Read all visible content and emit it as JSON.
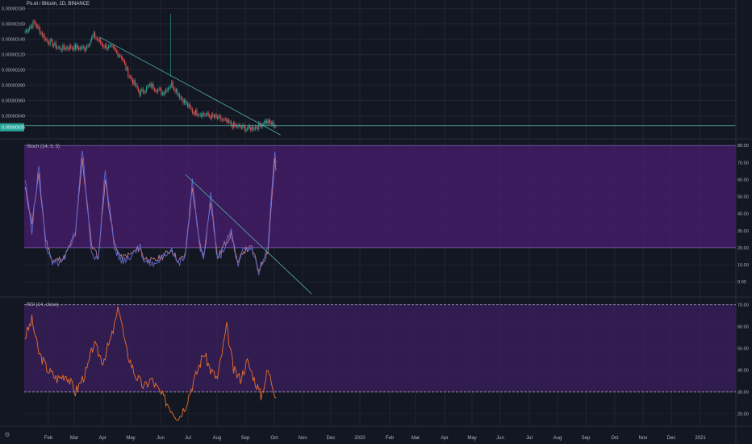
{
  "symbol": {
    "title": "Po.et / Bitcoin, 1D, BINANCE"
  },
  "colors": {
    "background": "#131722",
    "grid": "#2a2e39",
    "up": "#26a69a",
    "down": "#ef5350",
    "trendline": "#4fb2a6",
    "stoch_k": "#5b6cd6",
    "stoch_d": "#c07a8e",
    "stoch_band": "#4a1d70",
    "rsi_line": "#e8702a",
    "rsi_band": "#3a1e5c",
    "price_badge": "#26a69a"
  },
  "icons": {
    "settings": "gear-icon"
  },
  "chart_data": [
    {
      "type": "candlestick",
      "pane": "price",
      "title": "Po.et / Bitcoin, 1D, BINANCE",
      "ylim": [
        1.2e-07,
        1.85e-06
      ],
      "y_ticks": [
        "0.00000180",
        "0.00000160",
        "0.00000140",
        "0.00000120",
        "0.00000100",
        "0.00000080",
        "0.00000060",
        "0.00000040"
      ],
      "last_price_label": "0.00000025",
      "last_price": 2.5e-07,
      "series": [
        {
          "name": "",
          "x_index_range": [
            0,
            219
          ],
          "anchors": [
            [
              0,
              1.5e-06
            ],
            [
              8,
              1.62e-06
            ],
            [
              18,
              1.4e-06
            ],
            [
              30,
              1.28e-06
            ],
            [
              40,
              1.3e-06
            ],
            [
              52,
              1.28e-06
            ],
            [
              60,
              1.45e-06
            ],
            [
              68,
              1.32e-06
            ],
            [
              76,
              1.28e-06
            ],
            [
              84,
              1.18e-06
            ],
            [
              90,
              9.5e-07
            ],
            [
              100,
              7e-07
            ],
            [
              110,
              8e-07
            ],
            [
              120,
              7e-07
            ],
            [
              128,
              8.2e-07
            ],
            [
              136,
              6.4e-07
            ],
            [
              146,
              4.6e-07
            ],
            [
              156,
              4.2e-07
            ],
            [
              170,
              3.6e-07
            ],
            [
              182,
              2.7e-07
            ],
            [
              195,
              2.3e-07
            ],
            [
              204,
              2.7e-07
            ],
            [
              210,
              3.3e-07
            ],
            [
              219,
              2.7e-07
            ]
          ]
        }
      ],
      "trendlines": [
        {
          "from": [
            65,
            1.43e-06
          ],
          "to": [
            223,
            1.5e-07
          ]
        },
        {
          "from": [
            0,
            2.7e-07
          ],
          "to": [
            620,
            2.7e-07
          ]
        }
      ]
    },
    {
      "type": "line",
      "pane": "stoch",
      "title": "Stoch (14, 3, 3)",
      "ylim": [
        -8,
        82
      ],
      "y_ticks": [
        "80.00",
        "70.00",
        "60.00",
        "50.00",
        "40.00",
        "30.00",
        "20.00",
        "10.00",
        "0.00"
      ],
      "band": [
        20,
        80
      ],
      "series": [
        {
          "name": "",
          "x_index_range": [
            0,
            219
          ],
          "anchors": [
            [
              0,
              60
            ],
            [
              6,
              30
            ],
            [
              12,
              68
            ],
            [
              18,
              22
            ],
            [
              24,
              10
            ],
            [
              34,
              12
            ],
            [
              44,
              30
            ],
            [
              50,
              78
            ],
            [
              58,
              18
            ],
            [
              64,
              12
            ],
            [
              70,
              66
            ],
            [
              78,
              20
            ],
            [
              84,
              12
            ],
            [
              92,
              15
            ],
            [
              100,
              22
            ],
            [
              104,
              12
            ],
            [
              112,
              10
            ],
            [
              120,
              14
            ],
            [
              128,
              20
            ],
            [
              134,
              10
            ],
            [
              140,
              15
            ],
            [
              146,
              60
            ],
            [
              152,
              22
            ],
            [
              156,
              12
            ],
            [
              162,
              52
            ],
            [
              168,
              12
            ],
            [
              174,
              20
            ],
            [
              180,
              30
            ],
            [
              186,
              8
            ],
            [
              190,
              18
            ],
            [
              198,
              20
            ],
            [
              204,
              5
            ],
            [
              212,
              20
            ],
            [
              218,
              78
            ],
            [
              224,
              22
            ],
            [
              228,
              12
            ]
          ]
        },
        {
          "name": "",
          "x_index_range": [
            0,
            219
          ],
          "anchors": [
            [
              0,
              55
            ],
            [
              6,
              35
            ],
            [
              12,
              62
            ],
            [
              18,
              25
            ],
            [
              24,
              12
            ],
            [
              34,
              14
            ],
            [
              44,
              28
            ],
            [
              50,
              72
            ],
            [
              58,
              22
            ],
            [
              64,
              14
            ],
            [
              70,
              60
            ],
            [
              78,
              22
            ],
            [
              84,
              14
            ],
            [
              92,
              16
            ],
            [
              100,
              20
            ],
            [
              104,
              14
            ],
            [
              112,
              12
            ],
            [
              120,
              15
            ],
            [
              128,
              19
            ],
            [
              134,
              12
            ],
            [
              140,
              16
            ],
            [
              146,
              55
            ],
            [
              152,
              24
            ],
            [
              156,
              14
            ],
            [
              162,
              48
            ],
            [
              168,
              14
            ],
            [
              174,
              22
            ],
            [
              180,
              28
            ],
            [
              186,
              10
            ],
            [
              190,
              18
            ],
            [
              198,
              20
            ],
            [
              204,
              7
            ],
            [
              212,
              18
            ],
            [
              218,
              72
            ],
            [
              224,
              26
            ],
            [
              228,
              14
            ]
          ]
        }
      ],
      "trendlines": [
        {
          "from": [
            140,
            63
          ],
          "to": [
            250,
            -7
          ]
        }
      ]
    },
    {
      "type": "line",
      "pane": "rsi",
      "title": "RSI (14, close)",
      "ylim": [
        15,
        72
      ],
      "y_ticks": [
        "70.00",
        "60.00",
        "50.00",
        "40.00",
        "30.00",
        "20.00"
      ],
      "band": [
        30,
        70
      ],
      "series": [
        {
          "name": "",
          "x_index_range": [
            0,
            219
          ],
          "anchors": [
            [
              0,
              55
            ],
            [
              6,
              63
            ],
            [
              12,
              48
            ],
            [
              20,
              40
            ],
            [
              28,
              36
            ],
            [
              36,
              38
            ],
            [
              44,
              30
            ],
            [
              54,
              40
            ],
            [
              60,
              52
            ],
            [
              68,
              44
            ],
            [
              76,
              56
            ],
            [
              82,
              69
            ],
            [
              88,
              50
            ],
            [
              96,
              38
            ],
            [
              104,
              32
            ],
            [
              110,
              36
            ],
            [
              120,
              28
            ],
            [
              128,
              22
            ],
            [
              134,
              18
            ],
            [
              140,
              24
            ],
            [
              148,
              36
            ],
            [
              156,
              48
            ],
            [
              162,
              40
            ],
            [
              168,
              36
            ],
            [
              176,
              60
            ],
            [
              182,
              40
            ],
            [
              188,
              36
            ],
            [
              194,
              44
            ],
            [
              200,
              36
            ],
            [
              206,
              28
            ],
            [
              212,
              40
            ],
            [
              218,
              30
            ],
            [
              224,
              24
            ],
            [
              228,
              22
            ],
            [
              232,
              30
            ],
            [
              236,
              34
            ],
            [
              240,
              50
            ],
            [
              244,
              62
            ],
            [
              248,
              48
            ],
            [
              252,
              52
            ],
            [
              258,
              50
            ]
          ]
        }
      ]
    }
  ],
  "x_axis": {
    "labels": [
      "Feb",
      "Mar",
      "Apr",
      "May",
      "Jun",
      "Jul",
      "Aug",
      "Sep",
      "Oct",
      "Nov",
      "Dec",
      "2020",
      "Feb",
      "Mar",
      "Apr",
      "May",
      "Jun",
      "Jul",
      "Aug",
      "Sep",
      "Oct",
      "Nov",
      "Dec",
      "2021"
    ]
  }
}
